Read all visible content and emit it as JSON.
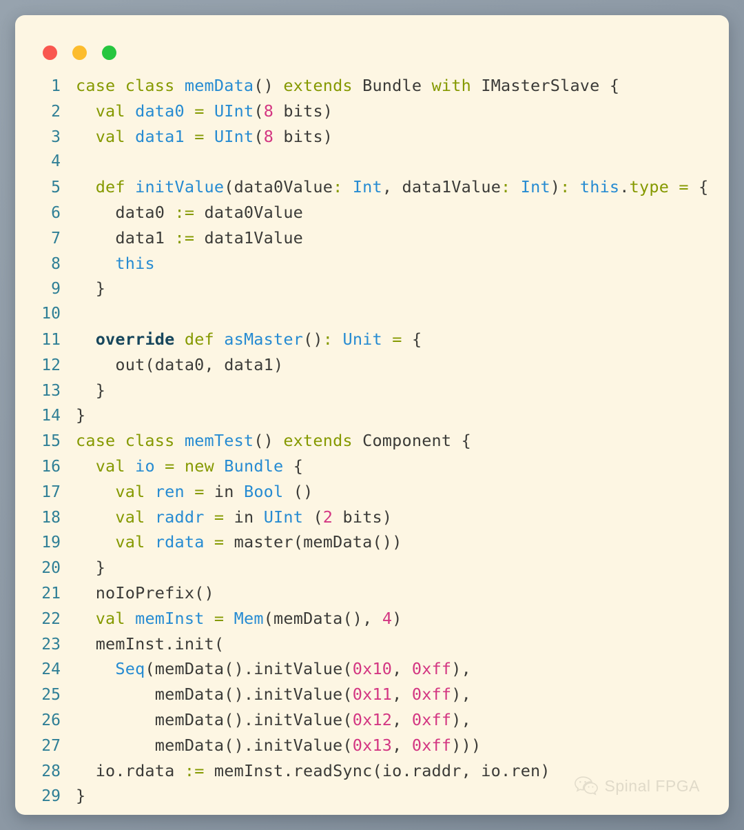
{
  "window": {
    "traffic_lights": [
      {
        "name": "close",
        "color": "#f9574f"
      },
      {
        "name": "minimize",
        "color": "#fcbc2d"
      },
      {
        "name": "maximize",
        "color": "#26c63f"
      }
    ],
    "background_color": "#8e9aa6",
    "card_color": "#fdf6e3"
  },
  "theme": {
    "keyword_color": "#859900",
    "identifier_color": "#268bd2",
    "number_color": "#d33682",
    "plain_color": "#3b3b38",
    "override_color": "#17465c",
    "line_number_color": "#2f7f96"
  },
  "watermark": {
    "icon": "wechat-icon",
    "label": "Spinal FPGA"
  },
  "code": {
    "language": "scala",
    "line_count": 29,
    "lines": [
      {
        "no": "1",
        "text": "case class memData() extends Bundle with IMasterSlave {"
      },
      {
        "no": "2",
        "text": "  val data0 = UInt(8 bits)"
      },
      {
        "no": "3",
        "text": "  val data1 = UInt(8 bits)"
      },
      {
        "no": "4",
        "text": ""
      },
      {
        "no": "5",
        "text": "  def initValue(data0Value: Int, data1Value: Int): this.type = {"
      },
      {
        "no": "6",
        "text": "    data0 := data0Value"
      },
      {
        "no": "7",
        "text": "    data1 := data1Value"
      },
      {
        "no": "8",
        "text": "    this"
      },
      {
        "no": "9",
        "text": "  }"
      },
      {
        "no": "10",
        "text": ""
      },
      {
        "no": "11",
        "text": "  override def asMaster(): Unit = {"
      },
      {
        "no": "12",
        "text": "    out(data0, data1)"
      },
      {
        "no": "13",
        "text": "  }"
      },
      {
        "no": "14",
        "text": "}"
      },
      {
        "no": "15",
        "text": "case class memTest() extends Component {"
      },
      {
        "no": "16",
        "text": "  val io = new Bundle {"
      },
      {
        "no": "17",
        "text": "    val ren = in Bool ()"
      },
      {
        "no": "18",
        "text": "    val raddr = in UInt (2 bits)"
      },
      {
        "no": "19",
        "text": "    val rdata = master(memData())"
      },
      {
        "no": "20",
        "text": "  }"
      },
      {
        "no": "21",
        "text": "  noIoPrefix()"
      },
      {
        "no": "22",
        "text": "  val memInst = Mem(memData(), 4)"
      },
      {
        "no": "23",
        "text": "  memInst.init("
      },
      {
        "no": "24",
        "text": "    Seq(memData().initValue(0x10, 0xff),"
      },
      {
        "no": "25",
        "text": "        memData().initValue(0x11, 0xff),"
      },
      {
        "no": "26",
        "text": "        memData().initValue(0x12, 0xff),"
      },
      {
        "no": "27",
        "text": "        memData().initValue(0x13, 0xff)))"
      },
      {
        "no": "28",
        "text": "  io.rdata := memInst.readSync(io.raddr, io.ren)"
      },
      {
        "no": "29",
        "text": "}"
      }
    ],
    "tokens": [
      [
        [
          "k",
          "case class "
        ],
        [
          "id",
          "memData"
        ],
        [
          "p",
          "() "
        ],
        [
          "k",
          "extends"
        ],
        [
          "p",
          " Bundle "
        ],
        [
          "k",
          "with"
        ],
        [
          "p",
          " IMasterSlave {"
        ]
      ],
      [
        [
          "p",
          "  "
        ],
        [
          "k",
          "val "
        ],
        [
          "id",
          "data0"
        ],
        [
          "p",
          " "
        ],
        [
          "k",
          "="
        ],
        [
          "p",
          " "
        ],
        [
          "id",
          "UInt"
        ],
        [
          "p",
          "("
        ],
        [
          "n",
          "8"
        ],
        [
          "p",
          " bits)"
        ]
      ],
      [
        [
          "p",
          "  "
        ],
        [
          "k",
          "val "
        ],
        [
          "id",
          "data1"
        ],
        [
          "p",
          " "
        ],
        [
          "k",
          "="
        ],
        [
          "p",
          " "
        ],
        [
          "id",
          "UInt"
        ],
        [
          "p",
          "("
        ],
        [
          "n",
          "8"
        ],
        [
          "p",
          " bits)"
        ]
      ],
      [
        [
          "p",
          ""
        ]
      ],
      [
        [
          "p",
          "  "
        ],
        [
          "k",
          "def "
        ],
        [
          "id",
          "initValue"
        ],
        [
          "p",
          "(data0Value"
        ],
        [
          "k",
          ":"
        ],
        [
          "p",
          " "
        ],
        [
          "id",
          "Int"
        ],
        [
          "p",
          ", data1Value"
        ],
        [
          "k",
          ":"
        ],
        [
          "p",
          " "
        ],
        [
          "id",
          "Int"
        ],
        [
          "p",
          ")"
        ],
        [
          "k",
          ":"
        ],
        [
          "p",
          " "
        ],
        [
          "id",
          "this"
        ],
        [
          "p",
          "."
        ],
        [
          "k",
          "type"
        ],
        [
          "p",
          " "
        ],
        [
          "k",
          "="
        ],
        [
          "p",
          " {"
        ]
      ],
      [
        [
          "p",
          "    data0 "
        ],
        [
          "k",
          ":="
        ],
        [
          "p",
          " data0Value"
        ]
      ],
      [
        [
          "p",
          "    data1 "
        ],
        [
          "k",
          ":="
        ],
        [
          "p",
          " data1Value"
        ]
      ],
      [
        [
          "p",
          "    "
        ],
        [
          "id",
          "this"
        ]
      ],
      [
        [
          "p",
          "  }"
        ]
      ],
      [
        [
          "p",
          ""
        ]
      ],
      [
        [
          "p",
          "  "
        ],
        [
          "ov",
          "override"
        ],
        [
          "p",
          " "
        ],
        [
          "k",
          "def "
        ],
        [
          "id",
          "asMaster"
        ],
        [
          "p",
          "()"
        ],
        [
          "k",
          ":"
        ],
        [
          "p",
          " "
        ],
        [
          "id",
          "Unit"
        ],
        [
          "p",
          " "
        ],
        [
          "k",
          "="
        ],
        [
          "p",
          " {"
        ]
      ],
      [
        [
          "p",
          "    out(data0, data1)"
        ]
      ],
      [
        [
          "p",
          "  }"
        ]
      ],
      [
        [
          "p",
          "}"
        ]
      ],
      [
        [
          "k",
          "case class "
        ],
        [
          "id",
          "memTest"
        ],
        [
          "p",
          "() "
        ],
        [
          "k",
          "extends"
        ],
        [
          "p",
          " Component {"
        ]
      ],
      [
        [
          "p",
          "  "
        ],
        [
          "k",
          "val "
        ],
        [
          "id",
          "io"
        ],
        [
          "p",
          " "
        ],
        [
          "k",
          "="
        ],
        [
          "p",
          " "
        ],
        [
          "k",
          "new"
        ],
        [
          "p",
          " "
        ],
        [
          "id",
          "Bundle"
        ],
        [
          "p",
          " {"
        ]
      ],
      [
        [
          "p",
          "    "
        ],
        [
          "k",
          "val "
        ],
        [
          "id",
          "ren"
        ],
        [
          "p",
          " "
        ],
        [
          "k",
          "="
        ],
        [
          "p",
          " in "
        ],
        [
          "id",
          "Bool"
        ],
        [
          "p",
          " ()"
        ]
      ],
      [
        [
          "p",
          "    "
        ],
        [
          "k",
          "val "
        ],
        [
          "id",
          "raddr"
        ],
        [
          "p",
          " "
        ],
        [
          "k",
          "="
        ],
        [
          "p",
          " in "
        ],
        [
          "id",
          "UInt"
        ],
        [
          "p",
          " ("
        ],
        [
          "n",
          "2"
        ],
        [
          "p",
          " bits)"
        ]
      ],
      [
        [
          "p",
          "    "
        ],
        [
          "k",
          "val "
        ],
        [
          "id",
          "rdata"
        ],
        [
          "p",
          " "
        ],
        [
          "k",
          "="
        ],
        [
          "p",
          " master(memData())"
        ]
      ],
      [
        [
          "p",
          "  }"
        ]
      ],
      [
        [
          "p",
          "  noIoPrefix()"
        ]
      ],
      [
        [
          "p",
          "  "
        ],
        [
          "k",
          "val "
        ],
        [
          "id",
          "memInst"
        ],
        [
          "p",
          " "
        ],
        [
          "k",
          "="
        ],
        [
          "p",
          " "
        ],
        [
          "id",
          "Mem"
        ],
        [
          "p",
          "(memData(), "
        ],
        [
          "n",
          "4"
        ],
        [
          "p",
          ")"
        ]
      ],
      [
        [
          "p",
          "  memInst.init("
        ]
      ],
      [
        [
          "p",
          "    "
        ],
        [
          "id",
          "Seq"
        ],
        [
          "p",
          "(memData().initValue("
        ],
        [
          "n",
          "0x10"
        ],
        [
          "p",
          ", "
        ],
        [
          "n",
          "0xff"
        ],
        [
          "p",
          "),"
        ]
      ],
      [
        [
          "p",
          "        memData().initValue("
        ],
        [
          "n",
          "0x11"
        ],
        [
          "p",
          ", "
        ],
        [
          "n",
          "0xff"
        ],
        [
          "p",
          "),"
        ]
      ],
      [
        [
          "p",
          "        memData().initValue("
        ],
        [
          "n",
          "0x12"
        ],
        [
          "p",
          ", "
        ],
        [
          "n",
          "0xff"
        ],
        [
          "p",
          "),"
        ]
      ],
      [
        [
          "p",
          "        memData().initValue("
        ],
        [
          "n",
          "0x13"
        ],
        [
          "p",
          ", "
        ],
        [
          "n",
          "0xff"
        ],
        [
          "p",
          ")))"
        ]
      ],
      [
        [
          "p",
          "  io.rdata "
        ],
        [
          "k",
          ":="
        ],
        [
          "p",
          " memInst.readSync(io.raddr, io.ren)"
        ]
      ],
      [
        [
          "p",
          "}"
        ]
      ]
    ]
  }
}
